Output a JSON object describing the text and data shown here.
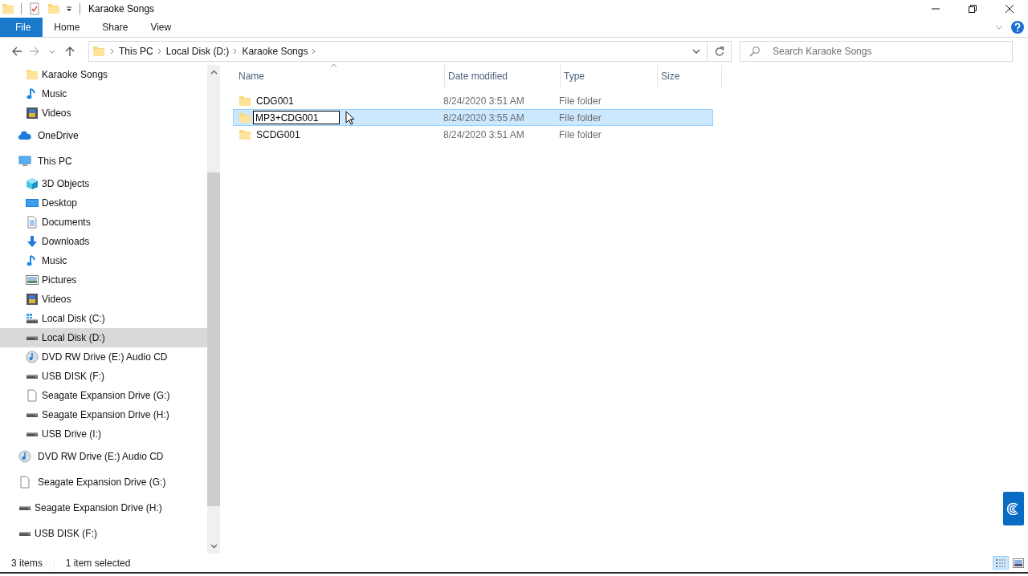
{
  "window": {
    "title": "Karaoke Songs"
  },
  "ribbon": {
    "tabs": [
      {
        "label": "File",
        "selected": true
      },
      {
        "label": "Home",
        "selected": false
      },
      {
        "label": "Share",
        "selected": false
      },
      {
        "label": "View",
        "selected": false
      }
    ]
  },
  "address_bar": {
    "crumbs": [
      "This PC",
      "Local Disk (D:)",
      "Karaoke Songs"
    ]
  },
  "search": {
    "placeholder": "Search Karaoke Songs"
  },
  "sidebar": {
    "pinned": [
      {
        "label": "Karaoke Songs",
        "kind": "folder",
        "selected": false
      },
      {
        "label": "Music",
        "kind": "music",
        "selected": false
      },
      {
        "label": "Videos",
        "kind": "video",
        "selected": false
      }
    ],
    "items": [
      {
        "label": "OneDrive",
        "kind": "cloud",
        "selected": false
      },
      {
        "label": "This PC",
        "kind": "pc",
        "selected": false,
        "children": [
          {
            "label": "3D Objects",
            "kind": "cube",
            "selected": false
          },
          {
            "label": "Desktop",
            "kind": "desktop",
            "selected": false
          },
          {
            "label": "Documents",
            "kind": "doc",
            "selected": false
          },
          {
            "label": "Downloads",
            "kind": "download",
            "selected": false
          },
          {
            "label": "Music",
            "kind": "music",
            "selected": false
          },
          {
            "label": "Pictures",
            "kind": "picture",
            "selected": false
          },
          {
            "label": "Videos",
            "kind": "video",
            "selected": false
          },
          {
            "label": "Local Disk (C:)",
            "kind": "windrive",
            "selected": false
          },
          {
            "label": "Local Disk (D:)",
            "kind": "drive",
            "selected": true
          },
          {
            "label": "DVD RW Drive (E:) Audio CD",
            "kind": "disc",
            "selected": false
          },
          {
            "label": "USB DISK (F:)",
            "kind": "drive",
            "selected": false
          },
          {
            "label": "Seagate Expansion Drive (G:)",
            "kind": "page",
            "selected": false
          },
          {
            "label": "Seagate Expansion Drive (H:)",
            "kind": "drive",
            "selected": false
          },
          {
            "label": "USB Drive (I:)",
            "kind": "drive",
            "selected": false
          }
        ]
      },
      {
        "label": "DVD RW Drive (E:) Audio CD",
        "kind": "disc",
        "selected": false
      },
      {
        "label": "Seagate Expansion Drive (G:)",
        "kind": "page",
        "selected": false
      },
      {
        "label": "Seagate Expansion Drive (H:)",
        "kind": "drive",
        "selected": false
      },
      {
        "label": "USB DISK (F:)",
        "kind": "drive",
        "selected": false
      }
    ]
  },
  "file_list": {
    "columns": [
      "Name",
      "Date modified",
      "Type",
      "Size"
    ],
    "rows": [
      {
        "name": "CDG001",
        "date": "8/24/2020 3:51 AM",
        "type": "File folder",
        "selected": false,
        "renaming": false
      },
      {
        "name": "MP3+CDG001",
        "date": "8/24/2020 3:55 AM",
        "type": "File folder",
        "selected": true,
        "renaming": true
      },
      {
        "name": "SCDG001",
        "date": "8/24/2020 3:51 AM",
        "type": "File folder",
        "selected": false,
        "renaming": false
      }
    ]
  },
  "status_bar": {
    "item_count": "3 items",
    "selection": "1 item selected"
  }
}
